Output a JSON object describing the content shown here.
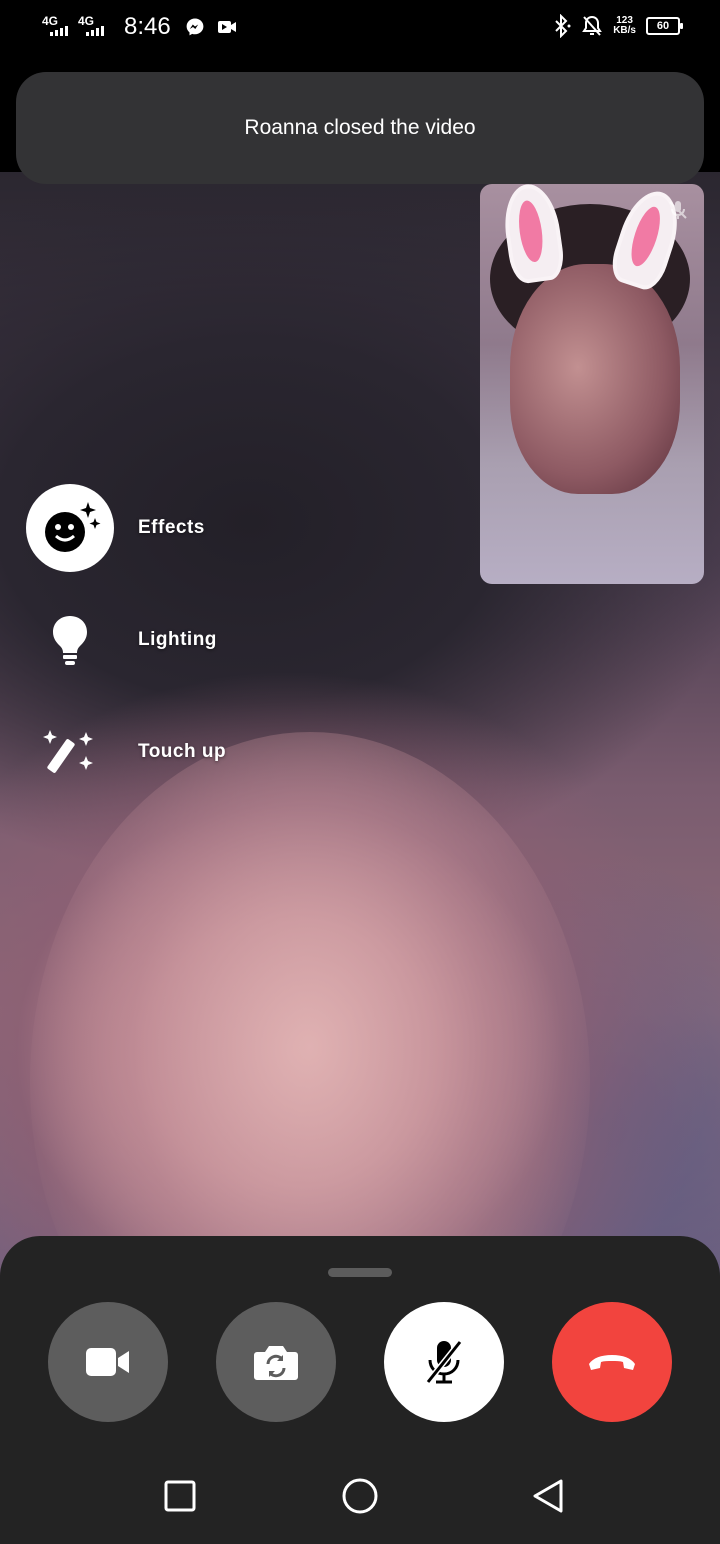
{
  "status_bar": {
    "network_1": "4G",
    "network_2": "4G",
    "time": "8:46",
    "app_icons": [
      "messenger-icon",
      "video-camera-icon"
    ],
    "right_icons": [
      "bluetooth-icon",
      "do-not-disturb-icon"
    ],
    "speed_value": "123",
    "speed_unit": "KB/s",
    "battery": "60"
  },
  "toast": {
    "message": "Roanna closed the video"
  },
  "effects_menu": {
    "items": [
      {
        "label": "Effects",
        "icon": "sparkle-face-icon",
        "active": true
      },
      {
        "label": "Lighting",
        "icon": "lightbulb-icon",
        "active": false
      },
      {
        "label": "Touch up",
        "icon": "magic-wand-icon",
        "active": false
      }
    ]
  },
  "controls": {
    "buttons": [
      {
        "name": "camera-toggle-button",
        "icon": "video-camera-icon"
      },
      {
        "name": "flip-camera-button",
        "icon": "camera-flip-icon"
      },
      {
        "name": "mute-button",
        "icon": "microphone-off-icon"
      },
      {
        "name": "end-call-button",
        "icon": "phone-hangup-icon"
      }
    ],
    "colors": {
      "sheet": "#232323",
      "gray_button": "#5d5d5d",
      "end_call": "#f2443e"
    }
  },
  "nav_bar": {
    "buttons": [
      "recents-square-icon",
      "home-circle-icon",
      "back-triangle-icon"
    ]
  }
}
